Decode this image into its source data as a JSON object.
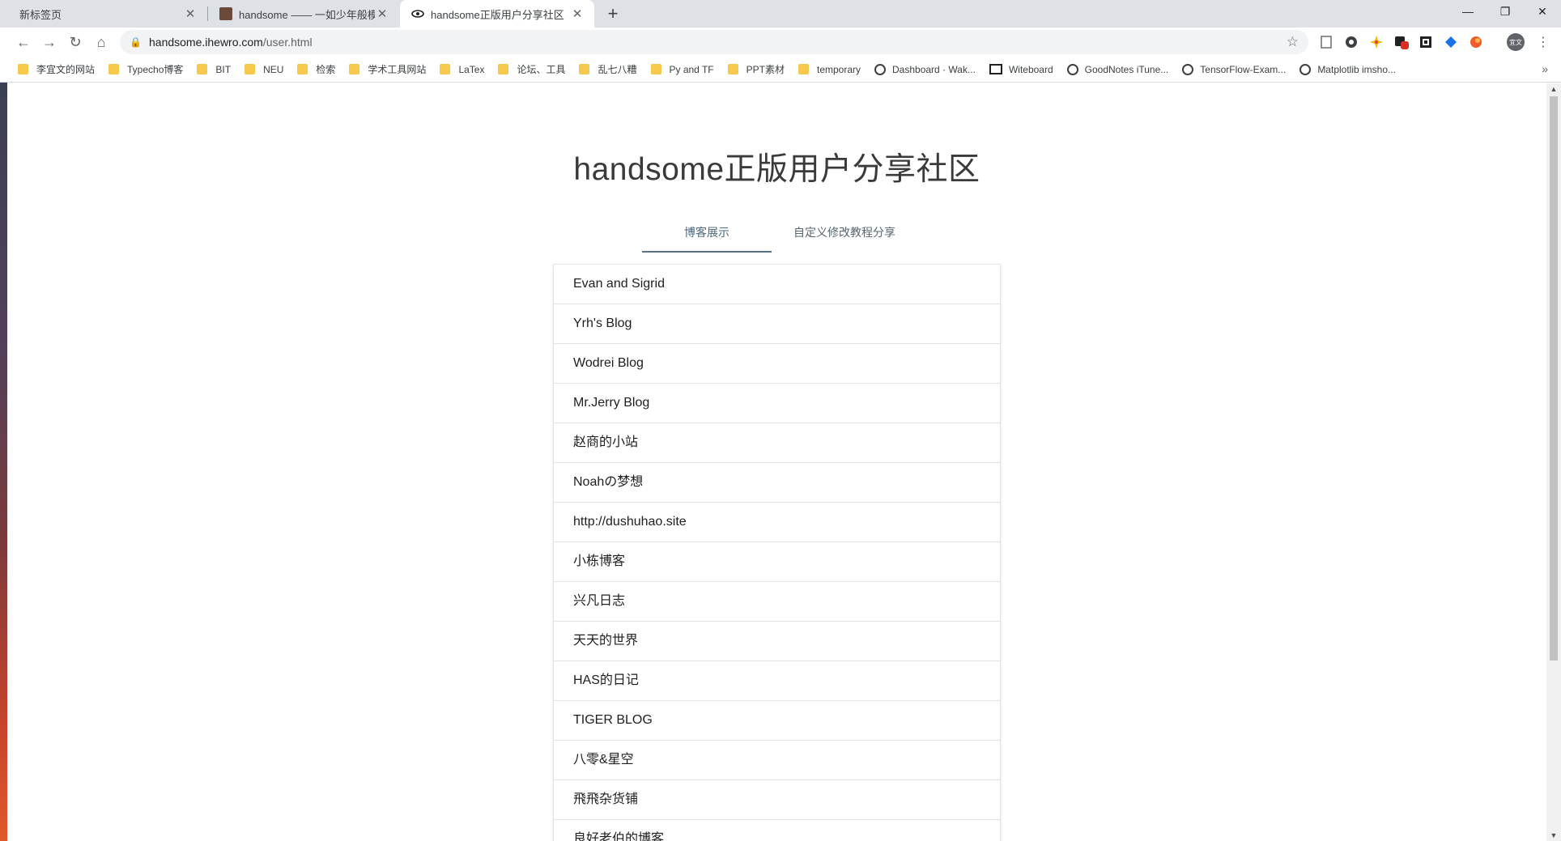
{
  "browser": {
    "tabs": [
      {
        "title": "新标签页",
        "active": false
      },
      {
        "title": "handsome —— 一如少年般模样",
        "active": false
      },
      {
        "title": "handsome正版用户分享社区",
        "active": true
      }
    ],
    "new_tab_symbol": "+",
    "window_controls": {
      "minimize": "—",
      "restore": "❐",
      "close": "✕"
    },
    "url": {
      "host": "handsome.ihewro.com",
      "path": "/user.html"
    },
    "bookmarks": [
      {
        "label": "李宜文的网站",
        "icon": "folder-icon"
      },
      {
        "label": "Typecho博客",
        "icon": "folder-icon"
      },
      {
        "label": "BIT",
        "icon": "folder-icon"
      },
      {
        "label": "NEU",
        "icon": "folder-icon"
      },
      {
        "label": "检索",
        "icon": "folder-icon"
      },
      {
        "label": "学术工具网站",
        "icon": "folder-icon"
      },
      {
        "label": "LaTex",
        "icon": "folder-icon"
      },
      {
        "label": "论坛、工具",
        "icon": "folder-icon"
      },
      {
        "label": "乱七八糟",
        "icon": "folder-icon"
      },
      {
        "label": "Py and TF",
        "icon": "folder-icon"
      },
      {
        "label": "PPT素材",
        "icon": "folder-icon"
      },
      {
        "label": "temporary",
        "icon": "folder-icon"
      },
      {
        "label": "Dashboard · Wak...",
        "icon": "clock-icon"
      },
      {
        "label": "Witeboard",
        "icon": "board-icon"
      },
      {
        "label": "GoodNotes iTune...",
        "icon": "globe-icon"
      },
      {
        "label": "TensorFlow-Exam...",
        "icon": "globe-icon"
      },
      {
        "label": "Matplotlib imsho...",
        "icon": "globe-icon"
      }
    ],
    "bookmarks_more": "»",
    "extension_badge": "1",
    "profile_text": "宜文"
  },
  "page": {
    "title": "handsome正版用户分享社区",
    "tabs": [
      {
        "label": "博客展示",
        "active": true
      },
      {
        "label": "自定义修改教程分享",
        "active": false
      }
    ],
    "blogs": [
      "Evan and Sigrid",
      "Yrh's Blog",
      "Wodrei Blog",
      "Mr.Jerry Blog",
      "赵商的小站",
      "Noahの梦想",
      "http://dushuhao.site",
      "小栋博客",
      "兴凡日志",
      "天天的世界",
      "HAS的日记",
      "TIGER BLOG",
      "八零&星空",
      "飛飛杂货铺",
      "良好老伯的博客"
    ]
  },
  "colors": {
    "tab_strip": "#dee1e6",
    "folder": "#f6c84c",
    "active_tab_underline": "#5a7182",
    "title_text": "#3a3a3a"
  }
}
